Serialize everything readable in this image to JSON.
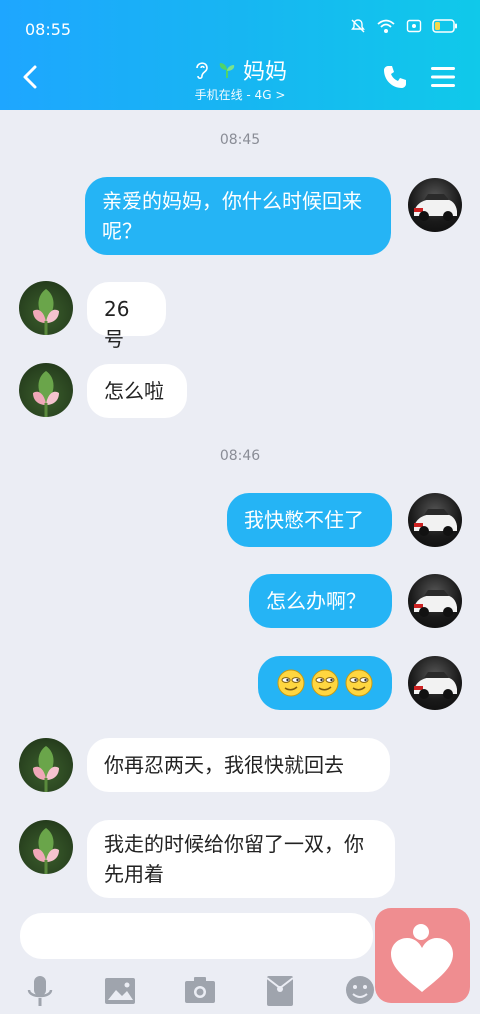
{
  "status": {
    "time": "08:55"
  },
  "header": {
    "contact_name": "妈妈",
    "subtitle": "手机在线 - 4G",
    "subtitle_chevron": ">"
  },
  "messages": [
    {
      "kind": "time",
      "text": "08:45"
    },
    {
      "kind": "out",
      "text": "亲爱的妈妈，你什么时候回来呢？"
    },
    {
      "kind": "in",
      "text": "26号"
    },
    {
      "kind": "in",
      "text": "怎么啦"
    },
    {
      "kind": "time",
      "text": "08:46"
    },
    {
      "kind": "out",
      "text": "我快憋不住了"
    },
    {
      "kind": "out",
      "text": "怎么办啊？"
    },
    {
      "kind": "out",
      "emoji_count": 3,
      "icon": "smirk-emoji-icon"
    },
    {
      "kind": "in",
      "text": "你再忍两天，我很快就回去"
    },
    {
      "kind": "in",
      "text": "我走的时候给你留了一双，你先用着"
    }
  ],
  "colors": {
    "header_start": "#1ea6ff",
    "header_end": "#10c9ea",
    "bubble_out": "#25b4f5",
    "bubble_in": "#ffffff",
    "background": "#ebedf4",
    "fab": "#ef8d90"
  },
  "toolbar": {
    "icons": [
      "microphone-icon",
      "image-icon",
      "camera-icon",
      "red-packet-icon",
      "emoji-icon"
    ]
  }
}
